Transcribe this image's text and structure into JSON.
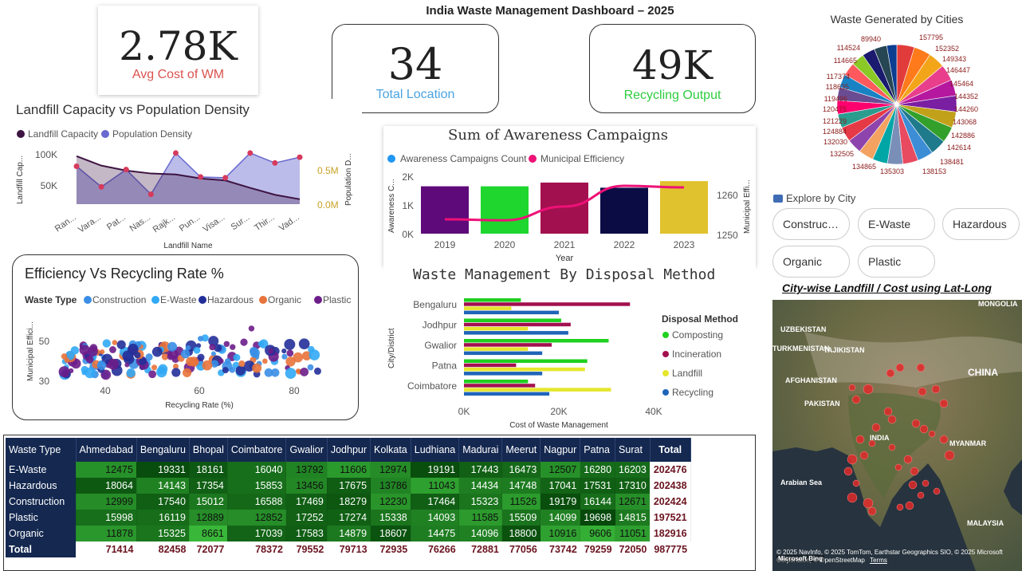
{
  "dashboard": {
    "title": "India Waste Management Dashboard – 2025"
  },
  "kpis": {
    "avg_cost": {
      "value": "2.78K",
      "label": "Avg Cost of WM",
      "color": "#d9534f"
    },
    "total_location": {
      "value": "34",
      "label": "Total Location",
      "color": "#4aa3df"
    },
    "recycling_output": {
      "value": "49K",
      "label": "Recycling Output",
      "color": "#2ecc40"
    }
  },
  "landfill_chart": {
    "title": "Landfill Capacity vs Population Density",
    "legend": [
      "Landfill Capacity",
      "Population Density"
    ],
    "ylabel_left": "Landfill Cap...",
    "ylabel_right": "Population D...",
    "xlabel": "Landfill Name",
    "y_ticks_left": [
      "100K",
      "50K"
    ],
    "y_ticks_right": [
      "0.5M",
      "0.0M"
    ]
  },
  "awareness_chart": {
    "title": "Sum of Awareness Campaigns",
    "legend": [
      "Awareness Campaigns Count",
      "Municipal Efficiency"
    ],
    "ylabel_left": "Awareness C...",
    "ylabel_right": "Municipal Effi...",
    "xlabel": "Year",
    "y_ticks_left": [
      "2K",
      "1K",
      "0K"
    ],
    "y_ticks_right": [
      "1260",
      "1250"
    ]
  },
  "efficiency_chart": {
    "title": "Efficiency Vs Recycling Rate %",
    "legend_title": "Waste Type",
    "legend": [
      "Construction",
      "E-Waste",
      "Hazardous",
      "Organic",
      "Plastic"
    ],
    "ylabel": "Municipal Effici...",
    "xlabel": "Recycling Rate (%)",
    "x_ticks": [
      "40",
      "60",
      "80"
    ],
    "y_ticks": [
      "50",
      "30"
    ]
  },
  "disposal_chart": {
    "title": "Waste Management By Disposal Method",
    "ylabel": "City/District",
    "xlabel": "Cost of Waste Management",
    "x_ticks": [
      "0K",
      "20K",
      "40K"
    ],
    "legend_title": "Disposal Method",
    "legend": [
      "Composting",
      "Incineration",
      "Landfill",
      "Recycling"
    ]
  },
  "pie_chart": {
    "title": "Waste Generated by Cities",
    "left_labels": [
      "89940",
      "114524",
      "114665",
      "117374",
      "118635",
      "119496",
      "120475",
      "121229",
      "124884",
      "132030",
      "132505",
      "134865",
      "135303"
    ],
    "right_labels": [
      "157795",
      "152352",
      "149343",
      "146447",
      "145464",
      "144352",
      "144260",
      "143068",
      "142886",
      "142614",
      "138481",
      "138153"
    ]
  },
  "slicer": {
    "title": "Explore by City",
    "options": [
      "Construct...",
      "E-Waste",
      "Hazardous",
      "Organic",
      "Plastic"
    ]
  },
  "map": {
    "title": "City-wise Landfill / Cost using Lat-Long",
    "labels": [
      "MONGOLIA",
      "UZBEKISTAN",
      "TURKMENISTAN",
      "TAJIKISTAN",
      "AFGHANISTAN",
      "PAKISTAN",
      "CHINA",
      "INDIA",
      "MYANMAR",
      "Arabian Sea",
      "MALAYSIA"
    ],
    "attribution": "© 2025 NavInfo, © 2025 TomTom, Earthstar Geographics SIO, © 2025 Microsoft Corporation, © OpenStreetMap",
    "terms": "Terms",
    "ms_label": "Microsoft Bing"
  },
  "matrix": {
    "row_header": "Waste Type",
    "columns": [
      "Ahmedabad",
      "Bengaluru",
      "Bhopal",
      "Coimbatore",
      "Gwalior",
      "Jodhpur",
      "Kolkata",
      "Ludhiana",
      "Madurai",
      "Meerut",
      "Nagpur",
      "Patna",
      "Surat",
      "Total"
    ],
    "rows": [
      {
        "name": "E-Waste",
        "values": [
          "12475",
          "19331",
          "18161",
          "16040",
          "13792",
          "11606",
          "12974",
          "19191",
          "17443",
          "16473",
          "12507",
          "16280",
          "16203"
        ],
        "total": "202476"
      },
      {
        "name": "Hazardous",
        "values": [
          "18064",
          "14143",
          "17354",
          "15853",
          "13456",
          "17675",
          "13786",
          "11043",
          "14434",
          "14748",
          "17041",
          "17531",
          "17310"
        ],
        "total": "202438"
      },
      {
        "name": "Construction",
        "values": [
          "12999",
          "17540",
          "15012",
          "16588",
          "17469",
          "18279",
          "12230",
          "17464",
          "15323",
          "11526",
          "19179",
          "16144",
          "12671"
        ],
        "total": "202424"
      },
      {
        "name": "Plastic",
        "values": [
          "15998",
          "16119",
          "12889",
          "12852",
          "17252",
          "17274",
          "15338",
          "14093",
          "11585",
          "15509",
          "14099",
          "19698",
          "14815"
        ],
        "total": "197521"
      },
      {
        "name": "Organic",
        "values": [
          "11878",
          "15325",
          "8661",
          "17039",
          "17583",
          "14879",
          "18607",
          "14475",
          "14096",
          "18800",
          "10916",
          "9606",
          "11051"
        ],
        "total": "182916"
      }
    ],
    "total_row": {
      "name": "Total",
      "values": [
        "71414",
        "82458",
        "72077",
        "78372",
        "79552",
        "79713",
        "72935",
        "76266",
        "72881",
        "77056",
        "73742",
        "79259",
        "72050"
      ],
      "total": "987775"
    }
  },
  "chart_data": [
    {
      "type": "area",
      "title": "Landfill Capacity vs Population Density",
      "categories": [
        "Ran...",
        "Vara...",
        "Pat...",
        "Nas...",
        "Rajk...",
        "Pun...",
        "Visa...",
        "Sur...",
        "Thir...",
        "Vad..."
      ],
      "series": [
        {
          "name": "Landfill Capacity",
          "values": [
            97000,
            78000,
            68000,
            62000,
            60000,
            52000,
            48000,
            33000,
            19000,
            10000
          ]
        },
        {
          "name": "Population Density",
          "values": [
            460000,
            210000,
            420000,
            120000,
            620000,
            330000,
            320000,
            620000,
            500000,
            570000
          ]
        }
      ],
      "xlabel": "Landfill Name",
      "ylabel": "Landfill Cap...",
      "ylim": [
        0,
        100000
      ],
      "ylim_right": [
        0,
        900000
      ]
    },
    {
      "type": "bar",
      "title": "Sum of Awareness Campaigns",
      "categories": [
        "2019",
        "2020",
        "2021",
        "2022",
        "2023"
      ],
      "series": [
        {
          "name": "Awareness Campaigns Count",
          "values": [
            1650,
            1650,
            1780,
            1600,
            1830
          ]
        },
        {
          "name": "Municipal Efficiency",
          "values": [
            1251.5,
            1251.2,
            1255.5,
            1262,
            1261.5
          ]
        }
      ],
      "xlabel": "Year",
      "ylim": [
        0,
        2000
      ],
      "ylim_right": [
        1247,
        1265
      ]
    },
    {
      "type": "scatter",
      "title": "Efficiency Vs Recycling Rate %",
      "xlabel": "Recycling Rate (%)",
      "ylabel": "Municipal Effici...",
      "xlim": [
        30,
        88
      ],
      "ylim": [
        30,
        62
      ],
      "series_names": [
        "Construction",
        "E-Waste",
        "Hazardous",
        "Organic",
        "Plastic"
      ]
    },
    {
      "type": "bar",
      "title": "Waste Management By Disposal Method",
      "categories": [
        "Bengaluru",
        "Jodhpur",
        "Gwalior",
        "Patna",
        "Coimbatore"
      ],
      "series": [
        {
          "name": "Composting",
          "values": [
            12000,
            20500,
            30500,
            26000,
            13500
          ]
        },
        {
          "name": "Incineration",
          "values": [
            35000,
            22500,
            18500,
            11000,
            15000
          ]
        },
        {
          "name": "Landfill",
          "values": [
            10000,
            13500,
            13500,
            25500,
            31000
          ]
        },
        {
          "name": "Recycling",
          "values": [
            20000,
            22000,
            16500,
            16500,
            18000
          ]
        }
      ],
      "xlabel": "Cost of Waste Management",
      "ylabel": "City/District",
      "xlim": [
        0,
        40000
      ]
    },
    {
      "type": "pie",
      "title": "Waste Generated by Cities",
      "values": [
        157795,
        152352,
        149343,
        146447,
        145464,
        144352,
        144260,
        143068,
        142886,
        142614,
        138481,
        138153,
        135303,
        134865,
        132505,
        132030,
        124884,
        121229,
        120475,
        119496,
        118635,
        117374,
        114665,
        114524,
        89940
      ]
    }
  ],
  "colors": {
    "construction": "#3a8ee6",
    "ewaste": "#31a9f5",
    "hazardous": "#232f99",
    "organic": "#e8733b",
    "plastic": "#6c1d8a",
    "composting": "#1fd11f",
    "incineration": "#a3104f",
    "landfill": "#e6e62e",
    "recycling": "#1f64b8",
    "landfill_area": "#3d1442",
    "popdensity_area": "#6a6ad0",
    "popdensity_point": "#d63a5c",
    "bars": [
      "#5e0a7a",
      "#1ed62e",
      "#a3104f",
      "#0c0c45",
      "#e0c22e"
    ],
    "efficiency_line": "#ee1177"
  }
}
